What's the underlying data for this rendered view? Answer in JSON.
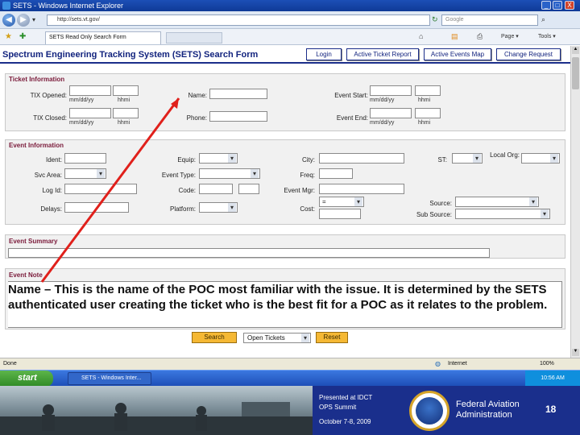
{
  "window": {
    "title": "SETS - Windows Internet Explorer",
    "min_label": "_",
    "max_label": "□",
    "close_label": "X"
  },
  "address_bar": {
    "back_label": "◀",
    "forward_label": "▶",
    "url": "http://sets.vt.gov/",
    "search_placeholder": "Google"
  },
  "tabs": {
    "active_tab_label": "SETS Read Only Search Form",
    "toolbar": [
      "Page ▾",
      "Tools ▾"
    ]
  },
  "sets": {
    "title": "Spectrum Engineering Tracking System (SETS) Search Form",
    "nav_buttons": [
      "Login",
      "Active Ticket Report",
      "Active Events Map",
      "Change Request"
    ]
  },
  "ticket_info": {
    "title": "Ticket Information",
    "tix_opened_label": "TIX Opened:",
    "tix_closed_label": "TIX Closed:",
    "date_hint": "mm/dd/yy",
    "time_hint": "hhmi",
    "name_label": "Name:",
    "phone_label": "Phone:",
    "event_start_label": "Event Start:",
    "event_end_label": "Event End:"
  },
  "event_info": {
    "title": "Event Information",
    "ident_label": "Ident:",
    "equip_label": "Equip:",
    "city_label": "City:",
    "st_label": "ST:",
    "local_org_label": "Local Org:",
    "svc_area_label": "Svc Area:",
    "event_type_label": "Event Type:",
    "freq_label": "Freq:",
    "log_id_label": "Log Id:",
    "code_label": "Code:",
    "event_mgr_label": "Event Mgr:",
    "delays_label": "Delays:",
    "platform_label": "Platform:",
    "cost_label": "Cost:",
    "cost_value": "=",
    "source_label": "Source:",
    "sub_source_label": "Sub Source:"
  },
  "event_summary": {
    "title": "Event Summary"
  },
  "event_note": {
    "title": "Event Note"
  },
  "callout": {
    "text": "Name – This is the name of the POC most familiar with the issue. It is determined by the SETS authenticated user creating the ticket who is the best fit for a POC as it relates to the problem."
  },
  "actions": {
    "search_label": "Search",
    "select_value": "Open Tickets",
    "reset_label": "Reset"
  },
  "status_bar": {
    "left": "Done",
    "zone": "Internet",
    "zoom": "100%"
  },
  "taskbar": {
    "start_label": "start",
    "item_label": "SETS - Windows Inter...",
    "clock": "10:56 AM"
  },
  "footer": {
    "presented_line1": "Presented at IDCT",
    "presented_line2": "OPS Summit",
    "date": "October 7-8, 2009",
    "agency_line1": "Federal Aviation",
    "agency_line2": "Administration",
    "page_number": "18"
  },
  "colors": {
    "form_title": "#12237e",
    "section_title": "#7a1a3a",
    "arrow": "#e0201b",
    "footer_band": "#1a2f8c"
  }
}
